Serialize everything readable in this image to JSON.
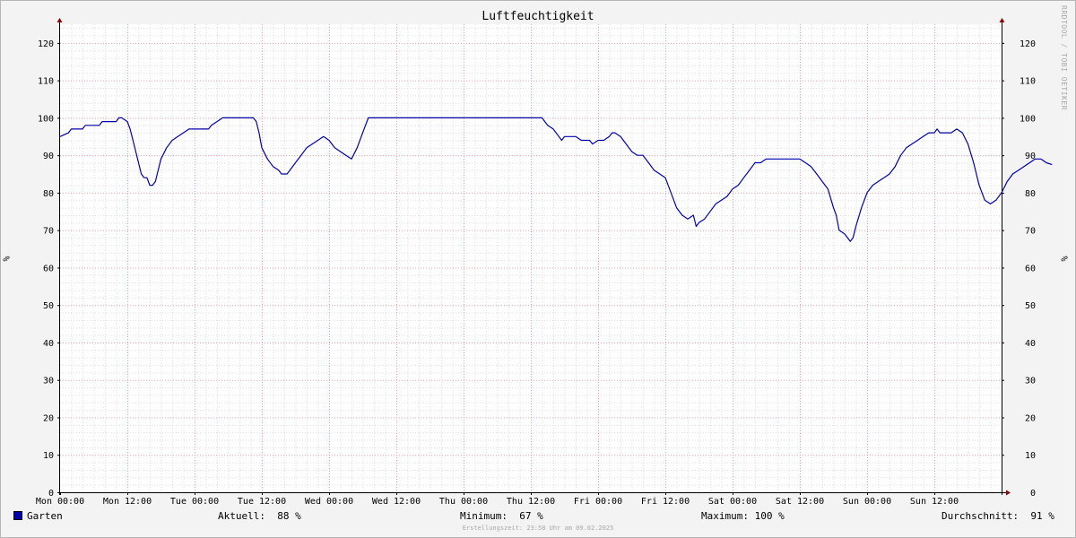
{
  "chart_data": {
    "type": "line",
    "title": "Luftfeuchtigkeit",
    "ylabel": "%",
    "ylim": [
      0,
      125
    ],
    "y_ticks": [
      0,
      10,
      20,
      30,
      40,
      50,
      60,
      70,
      80,
      90,
      100,
      110,
      120
    ],
    "x_ticks": [
      "Mon 00:00",
      "Mon 12:00",
      "Tue 00:00",
      "Tue 12:00",
      "Wed 00:00",
      "Wed 12:00",
      "Thu 00:00",
      "Thu 12:00",
      "Fri 00:00",
      "Fri 12:00",
      "Sat 00:00",
      "Sat 12:00",
      "Sun 00:00",
      "Sun 12:00"
    ],
    "x_range_hours": [
      0,
      168
    ],
    "grid": true,
    "series": [
      {
        "name": "Garten",
        "color": "#0000aa",
        "points": [
          [
            0,
            95
          ],
          [
            1.5,
            96
          ],
          [
            2,
            97
          ],
          [
            4,
            97
          ],
          [
            4.5,
            98
          ],
          [
            7,
            98
          ],
          [
            7.5,
            99
          ],
          [
            10,
            99
          ],
          [
            10.5,
            100
          ],
          [
            11,
            100
          ],
          [
            12,
            99
          ],
          [
            12.5,
            97
          ],
          [
            13,
            94
          ],
          [
            13.5,
            91
          ],
          [
            14,
            88
          ],
          [
            14.5,
            85
          ],
          [
            15,
            84
          ],
          [
            15.5,
            84
          ],
          [
            16,
            82
          ],
          [
            16.5,
            82
          ],
          [
            17,
            83
          ],
          [
            17.5,
            86
          ],
          [
            18,
            89
          ],
          [
            19,
            92
          ],
          [
            20,
            94
          ],
          [
            21,
            95
          ],
          [
            22,
            96
          ],
          [
            23,
            97
          ],
          [
            25,
            97
          ],
          [
            26.5,
            97
          ],
          [
            27,
            98
          ],
          [
            28,
            99
          ],
          [
            29,
            100
          ],
          [
            33,
            100
          ],
          [
            34.5,
            100
          ],
          [
            35,
            99
          ],
          [
            35.5,
            96
          ],
          [
            36,
            92
          ],
          [
            37,
            89
          ],
          [
            38,
            87
          ],
          [
            39,
            86
          ],
          [
            39.5,
            85
          ],
          [
            40.5,
            85
          ],
          [
            41,
            86
          ],
          [
            42,
            88
          ],
          [
            43,
            90
          ],
          [
            44,
            92
          ],
          [
            45,
            93
          ],
          [
            46,
            94
          ],
          [
            47,
            95
          ],
          [
            48,
            94
          ],
          [
            49,
            92
          ],
          [
            50,
            91
          ],
          [
            51,
            90
          ],
          [
            52,
            89
          ],
          [
            53,
            92
          ],
          [
            54,
            96
          ],
          [
            54.5,
            98
          ],
          [
            55,
            100
          ],
          [
            80,
            100
          ],
          [
            86,
            100
          ],
          [
            86.5,
            99
          ],
          [
            87,
            98
          ],
          [
            88,
            97
          ],
          [
            89,
            95
          ],
          [
            89.5,
            94
          ],
          [
            90,
            95
          ],
          [
            92,
            95
          ],
          [
            93,
            94
          ],
          [
            94.5,
            94
          ],
          [
            95,
            93
          ],
          [
            96,
            94
          ],
          [
            97,
            94
          ],
          [
            98,
            95
          ],
          [
            98.5,
            96
          ],
          [
            99,
            96
          ],
          [
            100,
            95
          ],
          [
            101,
            93
          ],
          [
            102,
            91
          ],
          [
            103,
            90
          ],
          [
            104,
            90
          ],
          [
            105,
            88
          ],
          [
            106,
            86
          ],
          [
            107,
            85
          ],
          [
            108,
            84
          ],
          [
            109,
            80
          ],
          [
            110,
            76
          ],
          [
            111,
            74
          ],
          [
            112,
            73
          ],
          [
            113,
            74
          ],
          [
            113.5,
            71
          ],
          [
            114,
            72
          ],
          [
            115,
            73
          ],
          [
            116,
            75
          ],
          [
            117,
            77
          ],
          [
            118,
            78
          ],
          [
            119,
            79
          ],
          [
            120,
            81
          ],
          [
            121,
            82
          ],
          [
            122,
            84
          ],
          [
            123,
            86
          ],
          [
            124,
            88
          ],
          [
            125,
            88
          ],
          [
            126,
            89
          ],
          [
            132,
            89
          ],
          [
            133,
            88
          ],
          [
            134,
            87
          ],
          [
            135,
            85
          ],
          [
            136,
            83
          ],
          [
            137,
            81
          ],
          [
            138,
            76
          ],
          [
            138.5,
            74
          ],
          [
            139,
            70
          ],
          [
            140,
            69
          ],
          [
            141,
            67
          ],
          [
            141.5,
            68
          ],
          [
            142,
            71
          ],
          [
            143,
            76
          ],
          [
            144,
            80
          ],
          [
            145,
            82
          ],
          [
            146,
            83
          ],
          [
            147,
            84
          ],
          [
            148,
            85
          ],
          [
            149,
            87
          ],
          [
            150,
            90
          ],
          [
            151,
            92
          ],
          [
            152,
            93
          ],
          [
            153,
            94
          ],
          [
            154,
            95
          ],
          [
            155,
            96
          ],
          [
            156,
            96
          ],
          [
            156.5,
            97
          ],
          [
            157,
            96
          ],
          [
            158,
            96
          ],
          [
            159,
            96
          ],
          [
            160,
            97
          ],
          [
            161,
            96
          ],
          [
            162,
            93
          ],
          [
            163,
            88
          ],
          [
            164,
            82
          ],
          [
            165,
            78
          ],
          [
            166,
            77
          ],
          [
            167,
            78
          ],
          [
            168,
            80
          ],
          [
            169,
            83
          ],
          [
            170,
            85
          ],
          [
            171,
            86
          ],
          [
            172,
            87
          ],
          [
            173,
            88
          ],
          [
            174,
            89
          ],
          [
            175,
            89
          ],
          [
            176,
            88
          ],
          [
            177,
            87.5
          ]
        ]
      }
    ]
  },
  "legend": {
    "series_label": "Garten",
    "current": "Aktuell:  88 %",
    "minimum": "Minimum:  67 %",
    "maximum": "Maximum: 100 %",
    "average": "Durchschnitt:  91 %"
  },
  "watermark": "RRDTOOL / TOBI OETIKER",
  "footer": "Erstellungszeit: 23:58 Uhr am 09.02.2025"
}
